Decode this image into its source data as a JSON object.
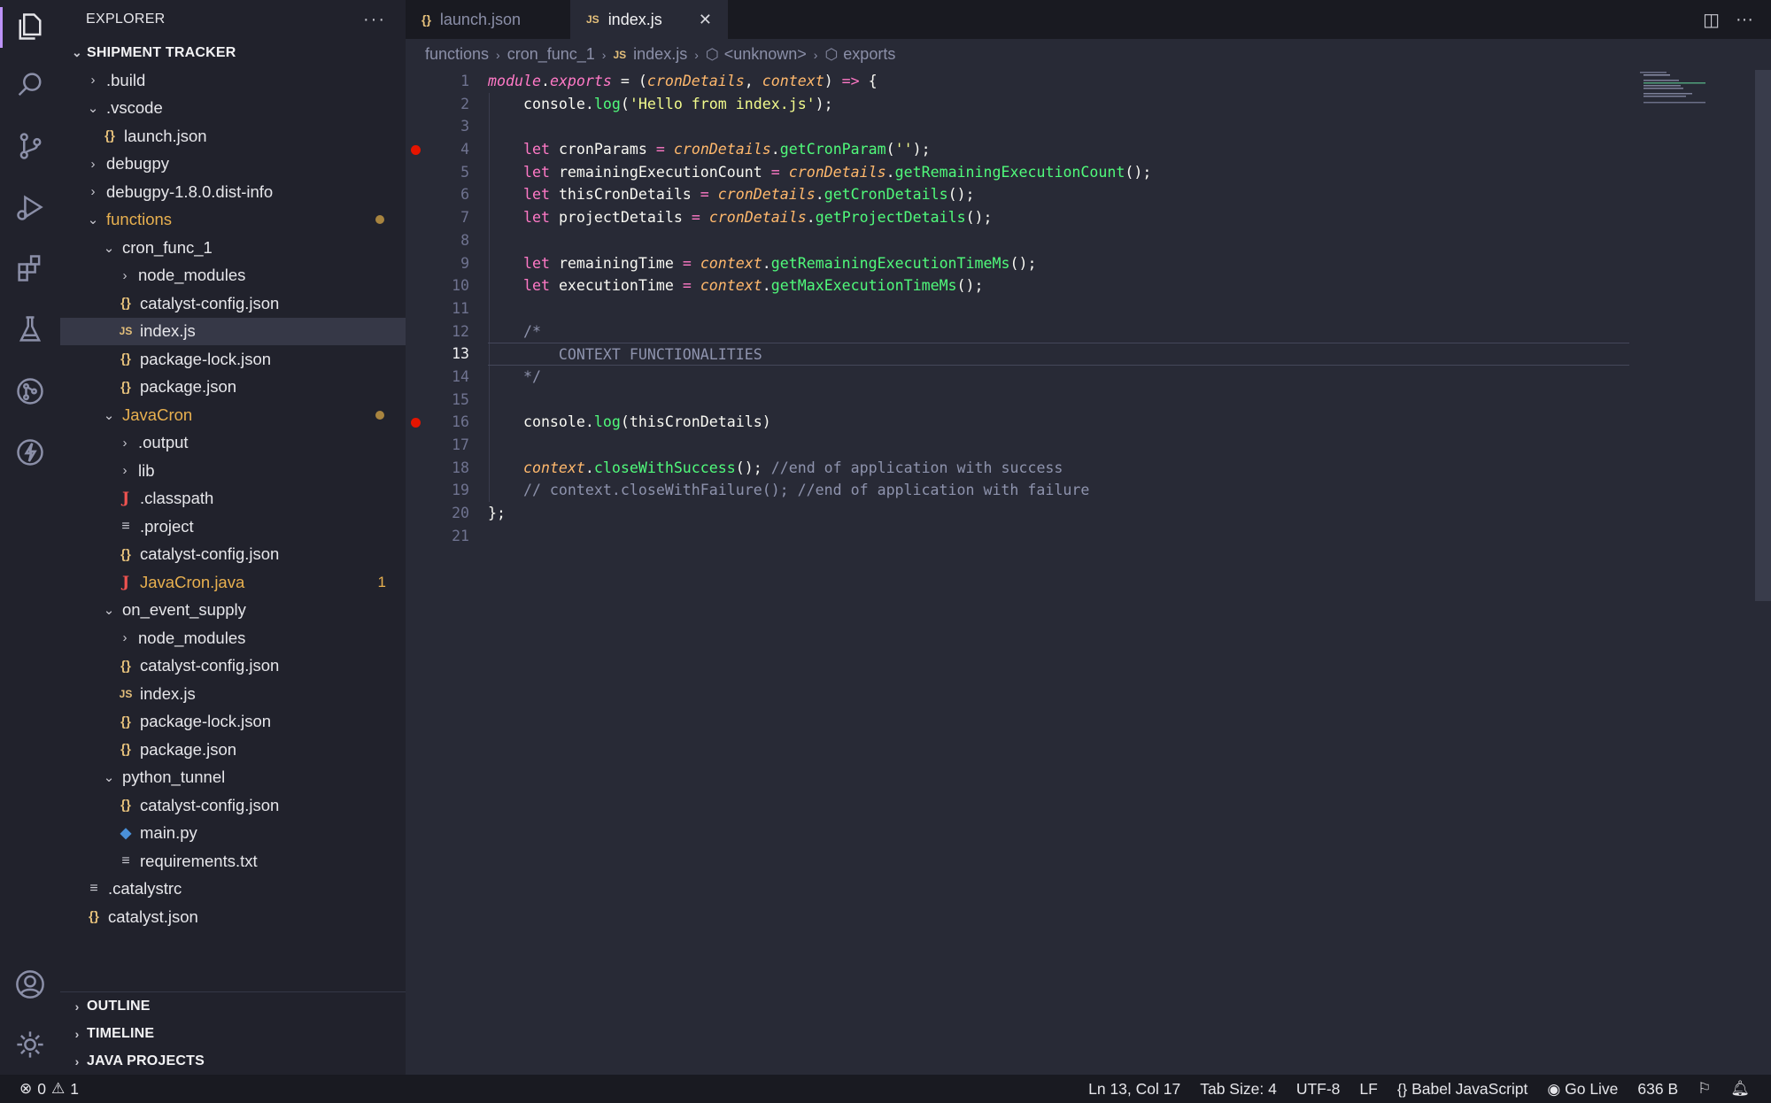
{
  "sidebar": {
    "title": "EXPLORER",
    "more": "···",
    "workspace": "SHIPMENT TRACKER",
    "tree": [
      {
        "label": ".build",
        "indent": 1,
        "chevron": "›",
        "icon": ""
      },
      {
        "label": ".vscode",
        "indent": 1,
        "chevron": "⌄",
        "icon": ""
      },
      {
        "label": "launch.json",
        "indent": 2,
        "chevron": "",
        "icon": "{}",
        "icon_type": "json"
      },
      {
        "label": "debugpy",
        "indent": 1,
        "chevron": "›",
        "icon": ""
      },
      {
        "label": "debugpy-1.8.0.dist-info",
        "indent": 1,
        "chevron": "›",
        "icon": ""
      },
      {
        "label": "functions",
        "indent": 1,
        "chevron": "⌄",
        "icon": "",
        "orange": true,
        "dot": true
      },
      {
        "label": "cron_func_1",
        "indent": 2,
        "chevron": "⌄",
        "icon": ""
      },
      {
        "label": "node_modules",
        "indent": 3,
        "chevron": "›",
        "icon": ""
      },
      {
        "label": "catalyst-config.json",
        "indent": 3,
        "chevron": "",
        "icon": "{}",
        "icon_type": "json"
      },
      {
        "label": "index.js",
        "indent": 3,
        "chevron": "",
        "icon": "JS",
        "icon_type": "js",
        "selected": true
      },
      {
        "label": "package-lock.json",
        "indent": 3,
        "chevron": "",
        "icon": "{}",
        "icon_type": "json"
      },
      {
        "label": "package.json",
        "indent": 3,
        "chevron": "",
        "icon": "{}",
        "icon_type": "json"
      },
      {
        "label": "JavaCron",
        "indent": 2,
        "chevron": "⌄",
        "icon": "",
        "orange": true,
        "dot": true
      },
      {
        "label": ".output",
        "indent": 3,
        "chevron": "›",
        "icon": ""
      },
      {
        "label": "lib",
        "indent": 3,
        "chevron": "›",
        "icon": ""
      },
      {
        "label": ".classpath",
        "indent": 3,
        "chevron": "",
        "icon": "J",
        "icon_type": "java"
      },
      {
        "label": ".project",
        "indent": 3,
        "chevron": "",
        "icon": "≡",
        "icon_type": "txt"
      },
      {
        "label": "catalyst-config.json",
        "indent": 3,
        "chevron": "",
        "icon": "{}",
        "icon_type": "json"
      },
      {
        "label": "JavaCron.java",
        "indent": 3,
        "chevron": "",
        "icon": "J",
        "icon_type": "java",
        "orange": true,
        "badge": "1"
      },
      {
        "label": "on_event_supply",
        "indent": 2,
        "chevron": "⌄",
        "icon": ""
      },
      {
        "label": "node_modules",
        "indent": 3,
        "chevron": "›",
        "icon": ""
      },
      {
        "label": "catalyst-config.json",
        "indent": 3,
        "chevron": "",
        "icon": "{}",
        "icon_type": "json"
      },
      {
        "label": "index.js",
        "indent": 3,
        "chevron": "",
        "icon": "JS",
        "icon_type": "js"
      },
      {
        "label": "package-lock.json",
        "indent": 3,
        "chevron": "",
        "icon": "{}",
        "icon_type": "json"
      },
      {
        "label": "package.json",
        "indent": 3,
        "chevron": "",
        "icon": "{}",
        "icon_type": "json"
      },
      {
        "label": "python_tunnel",
        "indent": 2,
        "chevron": "⌄",
        "icon": ""
      },
      {
        "label": "catalyst-config.json",
        "indent": 3,
        "chevron": "",
        "icon": "{}",
        "icon_type": "json"
      },
      {
        "label": "main.py",
        "indent": 3,
        "chevron": "",
        "icon": "◆",
        "icon_type": "py"
      },
      {
        "label": "requirements.txt",
        "indent": 3,
        "chevron": "",
        "icon": "≡",
        "icon_type": "txt"
      },
      {
        "label": ".catalystrc",
        "indent": 1,
        "chevron": "",
        "icon": "≡",
        "icon_type": "txt"
      },
      {
        "label": "catalyst.json",
        "indent": 1,
        "chevron": "",
        "icon": "{}",
        "icon_type": "json"
      }
    ],
    "bottom_sections": [
      "OUTLINE",
      "TIMELINE",
      "JAVA PROJECTS"
    ]
  },
  "tabs": [
    {
      "label": "launch.json",
      "icon": "{}",
      "active": false
    },
    {
      "label": "index.js",
      "icon": "JS",
      "active": true,
      "close": "✕"
    }
  ],
  "breadcrumbs": {
    "items": [
      "functions",
      "cron_func_1",
      "index.js",
      "<unknown>",
      "exports"
    ]
  },
  "editor": {
    "current_line": 13,
    "breakpoint_lines": [
      4,
      16
    ],
    "lines": [
      [
        [
          "module",
          "k-it"
        ],
        [
          ".",
          ""
        ],
        [
          "exports",
          "k-it"
        ],
        [
          " = (",
          ""
        ],
        [
          "cronDetails",
          "k-pr"
        ],
        [
          ", ",
          ""
        ],
        [
          "context",
          "k-pr"
        ],
        [
          ") ",
          ""
        ],
        [
          "=>",
          "k-op"
        ],
        [
          " {",
          ""
        ]
      ],
      [
        [
          "    console.",
          ""
        ],
        [
          "log",
          "k-gr"
        ],
        [
          "(",
          ""
        ],
        [
          "'Hello from index.js'",
          "k-st"
        ],
        [
          ");",
          ""
        ]
      ],
      [],
      [
        [
          "    ",
          ""
        ],
        [
          "let",
          "k-pk"
        ],
        [
          " cronParams ",
          ""
        ],
        [
          "=",
          "k-op"
        ],
        [
          " ",
          ""
        ],
        [
          "cronDetails",
          "k-pr"
        ],
        [
          ".",
          ""
        ],
        [
          "getCronParam",
          "k-gr"
        ],
        [
          "(",
          ""
        ],
        [
          "''",
          "k-st"
        ],
        [
          ");",
          ""
        ]
      ],
      [
        [
          "    ",
          ""
        ],
        [
          "let",
          "k-pk"
        ],
        [
          " remainingExecutionCount ",
          ""
        ],
        [
          "=",
          "k-op"
        ],
        [
          " ",
          ""
        ],
        [
          "cronDetails",
          "k-pr"
        ],
        [
          ".",
          ""
        ],
        [
          "getRemainingExecutionCount",
          "k-gr"
        ],
        [
          "();",
          ""
        ]
      ],
      [
        [
          "    ",
          ""
        ],
        [
          "let",
          "k-pk"
        ],
        [
          " thisCronDetails ",
          ""
        ],
        [
          "=",
          "k-op"
        ],
        [
          " ",
          ""
        ],
        [
          "cronDetails",
          "k-pr"
        ],
        [
          ".",
          ""
        ],
        [
          "getCronDetails",
          "k-gr"
        ],
        [
          "();",
          ""
        ]
      ],
      [
        [
          "    ",
          ""
        ],
        [
          "let",
          "k-pk"
        ],
        [
          " projectDetails ",
          ""
        ],
        [
          "=",
          "k-op"
        ],
        [
          " ",
          ""
        ],
        [
          "cronDetails",
          "k-pr"
        ],
        [
          ".",
          ""
        ],
        [
          "getProjectDetails",
          "k-gr"
        ],
        [
          "();",
          ""
        ]
      ],
      [],
      [
        [
          "    ",
          ""
        ],
        [
          "let",
          "k-pk"
        ],
        [
          " remainingTime ",
          ""
        ],
        [
          "=",
          "k-op"
        ],
        [
          " ",
          ""
        ],
        [
          "context",
          "k-pr"
        ],
        [
          ".",
          ""
        ],
        [
          "getRemainingExecutionTimeMs",
          "k-gr"
        ],
        [
          "();",
          ""
        ]
      ],
      [
        [
          "    ",
          ""
        ],
        [
          "let",
          "k-pk"
        ],
        [
          " executionTime ",
          ""
        ],
        [
          "=",
          "k-op"
        ],
        [
          " ",
          ""
        ],
        [
          "context",
          "k-pr"
        ],
        [
          ".",
          ""
        ],
        [
          "getMaxExecutionTimeMs",
          "k-gr"
        ],
        [
          "();",
          ""
        ]
      ],
      [],
      [
        [
          "    /*",
          "k-cm"
        ]
      ],
      [
        [
          "        CONTEXT FUNCTIONALITIES",
          "k-cm"
        ]
      ],
      [
        [
          "    */",
          "k-cm"
        ]
      ],
      [],
      [
        [
          "    console.",
          ""
        ],
        [
          "log",
          "k-gr"
        ],
        [
          "(thisCronDetails)",
          ""
        ]
      ],
      [],
      [
        [
          "    ",
          ""
        ],
        [
          "context",
          "k-pr"
        ],
        [
          ".",
          ""
        ],
        [
          "closeWithSuccess",
          "k-gr"
        ],
        [
          "(); ",
          ""
        ],
        [
          "//end of application with success",
          "k-cm"
        ]
      ],
      [
        [
          "    // context.closeWithFailure(); //end of application with failure",
          "k-cm"
        ]
      ],
      [
        [
          "}",
          ""
        ],
        [
          ";",
          ""
        ]
      ],
      []
    ]
  },
  "statusbar": {
    "errors": "0",
    "warnings": "1",
    "position": "Ln 13, Col 17",
    "tab_size": "Tab Size: 4",
    "encoding": "UTF-8",
    "eol": "LF",
    "language": "Babel JavaScript",
    "go_live": "Go Live",
    "file_size": "636 B"
  },
  "colors": {
    "activity_bg": "#21222c",
    "editor_bg": "#282a36",
    "accent": "#bd93f9",
    "breakpoint": "#e51400",
    "modified": "#e8b04f"
  }
}
